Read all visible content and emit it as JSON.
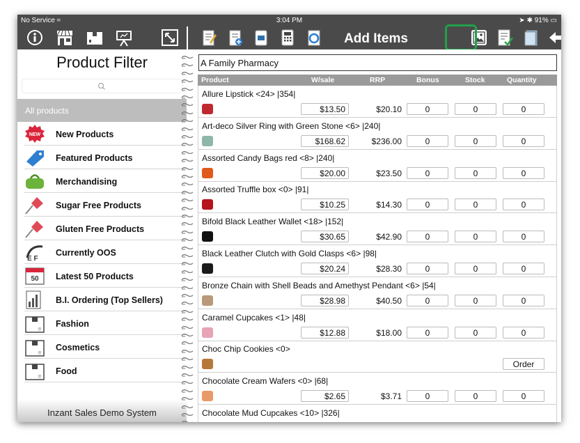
{
  "status": {
    "carrier": "No Service",
    "time": "3:04 PM",
    "battery": "91%"
  },
  "toolbar": {
    "title": "Add Items",
    "left_icons": [
      "info-icon",
      "store-icon",
      "box-icon",
      "presentation-icon",
      "expand-icon"
    ],
    "right_icons": [
      "notepad-edit-icon",
      "document-upload-icon",
      "sim-card-icon",
      "calculator-icon",
      "sync-icon"
    ],
    "right_end_icons": [
      "image-icon",
      "checklist-icon",
      "document-icon",
      "back-arrow-icon"
    ]
  },
  "left": {
    "title": "Product Filter",
    "search_placeholder": "",
    "all_products": "All products",
    "items": [
      {
        "label": "New Products",
        "icon": "new-badge-icon"
      },
      {
        "label": "Featured Products",
        "icon": "tag-icon"
      },
      {
        "label": "Merchandising",
        "icon": "bag-icon"
      },
      {
        "label": "Sugar Free Products",
        "icon": "pushpin-icon"
      },
      {
        "label": "Gluten Free Products",
        "icon": "pushpin-icon"
      },
      {
        "label": "Currently OOS",
        "icon": "oos-icon"
      },
      {
        "label": "Latest 50 Products",
        "icon": "calendar-50-icon"
      },
      {
        "label": "B.I. Ordering (Top Sellers)",
        "icon": "bar-chart-icon"
      },
      {
        "label": "Fashion",
        "icon": "box-icon"
      },
      {
        "label": "Cosmetics",
        "icon": "box-icon"
      },
      {
        "label": "Food",
        "icon": "box-icon"
      }
    ],
    "footer": "Inzant Sales Demo System"
  },
  "right": {
    "customer": "A Family Pharmacy",
    "columns": [
      "Product",
      "W/sale",
      "RRP",
      "Bonus",
      "Stock",
      "Quantity"
    ],
    "rows": [
      {
        "name": "Allure Lipstick <24> |354|",
        "wsale": "$13.50",
        "rrp": "$20.10",
        "bonus": "0",
        "stock": "0",
        "qty": "0",
        "color": "#c0282f"
      },
      {
        "name": "Art-deco Silver Ring with Green Stone <6> |240|",
        "wsale": "$168.62",
        "rrp": "$236.00",
        "bonus": "0",
        "stock": "0",
        "qty": "0",
        "color": "#8fb7a8"
      },
      {
        "name": "Assorted Candy Bags red <8> |240|",
        "wsale": "$20.00",
        "rrp": "$23.50",
        "bonus": "0",
        "stock": "0",
        "qty": "0",
        "color": "#e05a1c"
      },
      {
        "name": "Assorted Truffle box <0> |91|",
        "wsale": "$10.25",
        "rrp": "$14.30",
        "bonus": "0",
        "stock": "0",
        "qty": "0",
        "color": "#b5121b"
      },
      {
        "name": "Bifold Black Leather Wallet <18> |152|",
        "wsale": "$30.65",
        "rrp": "$42.90",
        "bonus": "0",
        "stock": "0",
        "qty": "0",
        "color": "#111111"
      },
      {
        "name": "Black Leather Clutch with Gold Clasps <6> |98|",
        "wsale": "$20.24",
        "rrp": "$28.30",
        "bonus": "0",
        "stock": "0",
        "qty": "0",
        "color": "#1a1a1a"
      },
      {
        "name": "Bronze Chain with Shell Beads and Amethyst Pendant <6> |54|",
        "wsale": "$28.98",
        "rrp": "$40.50",
        "bonus": "0",
        "stock": "0",
        "qty": "0",
        "color": "#b89a7a"
      },
      {
        "name": "Caramel Cupcakes <1> |48|",
        "wsale": "$12.88",
        "rrp": "$18.00",
        "bonus": "0",
        "stock": "0",
        "qty": "0",
        "color": "#e8a3b6"
      },
      {
        "name": "Choc Chip Cookies <0>",
        "order": "Order",
        "color": "#b7793a"
      },
      {
        "name": "Chocolate Cream Wafers <0> |68|",
        "wsale": "$2.65",
        "rrp": "$3.71",
        "bonus": "0",
        "stock": "0",
        "qty": "0",
        "color": "#e89a6a"
      },
      {
        "name": "Chocolate Mud Cupcakes  <10> |326|",
        "color": "#5a3a22"
      }
    ]
  },
  "colors": {
    "toolbar": "#4a4a4a",
    "highlight": "#22a04a",
    "header": "#9a9a9a",
    "selected": "#bdbdbd"
  }
}
